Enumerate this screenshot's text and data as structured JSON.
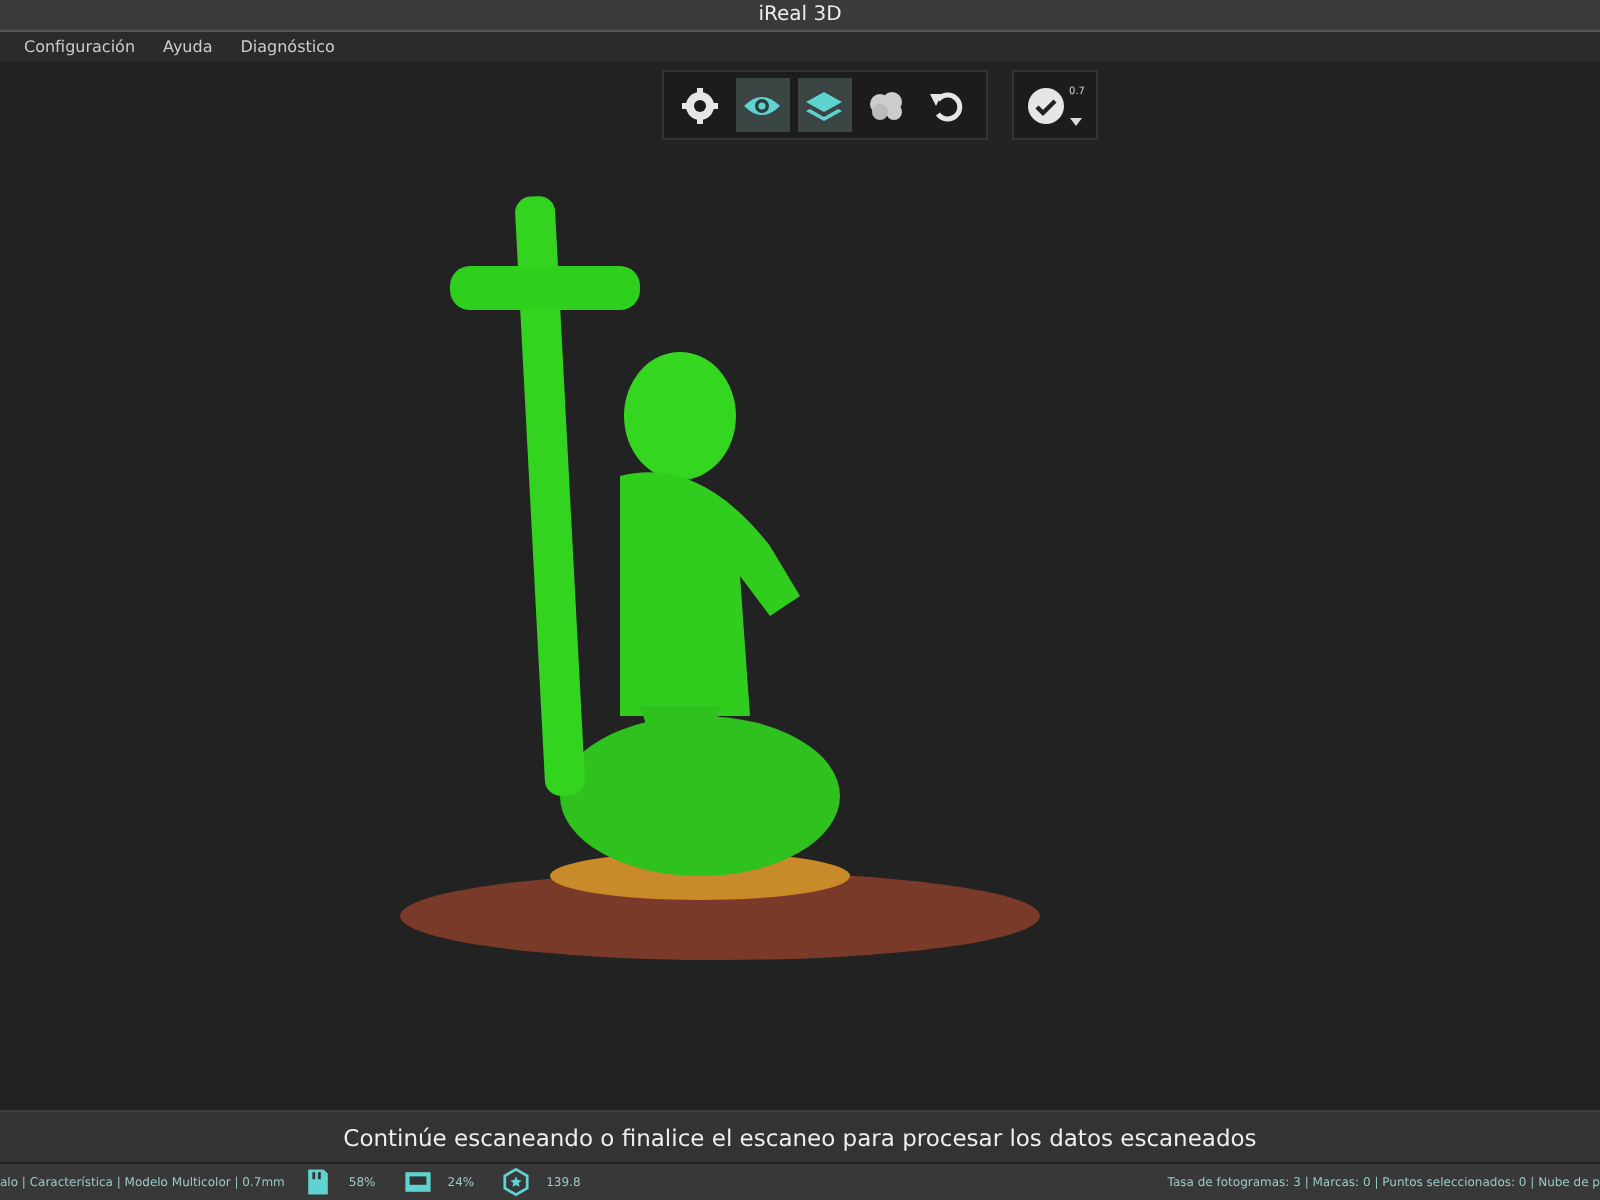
{
  "window": {
    "title": "iReal 3D"
  },
  "menu": [
    {
      "label": "Configuración"
    },
    {
      "label": "Ayuda"
    },
    {
      "label": "Diagnóstico"
    }
  ],
  "toolbar": [
    {
      "kind": "gear",
      "selected": false
    },
    {
      "kind": "eye",
      "selected": true
    },
    {
      "kind": "layers",
      "selected": true
    },
    {
      "kind": "cloud",
      "selected": false
    },
    {
      "kind": "undo",
      "selected": false
    }
  ],
  "confirm": {
    "value": "0.7"
  },
  "message": "Continúe escaneando o finalice el escaneo para procesar los datos escaneados",
  "status_bar": {
    "left": "alo | Característica | Modelo Multicolor | 0.7mm",
    "indicators": [
      {
        "kind": "storage",
        "text": "58%"
      },
      {
        "kind": "memory",
        "text": "24%"
      },
      {
        "kind": "badge",
        "text": "139.8"
      }
    ],
    "right": "Tasa de fotogramas: 3 | Marcas: 0 | Puntos seleccionados: 0 | Nube de p"
  }
}
